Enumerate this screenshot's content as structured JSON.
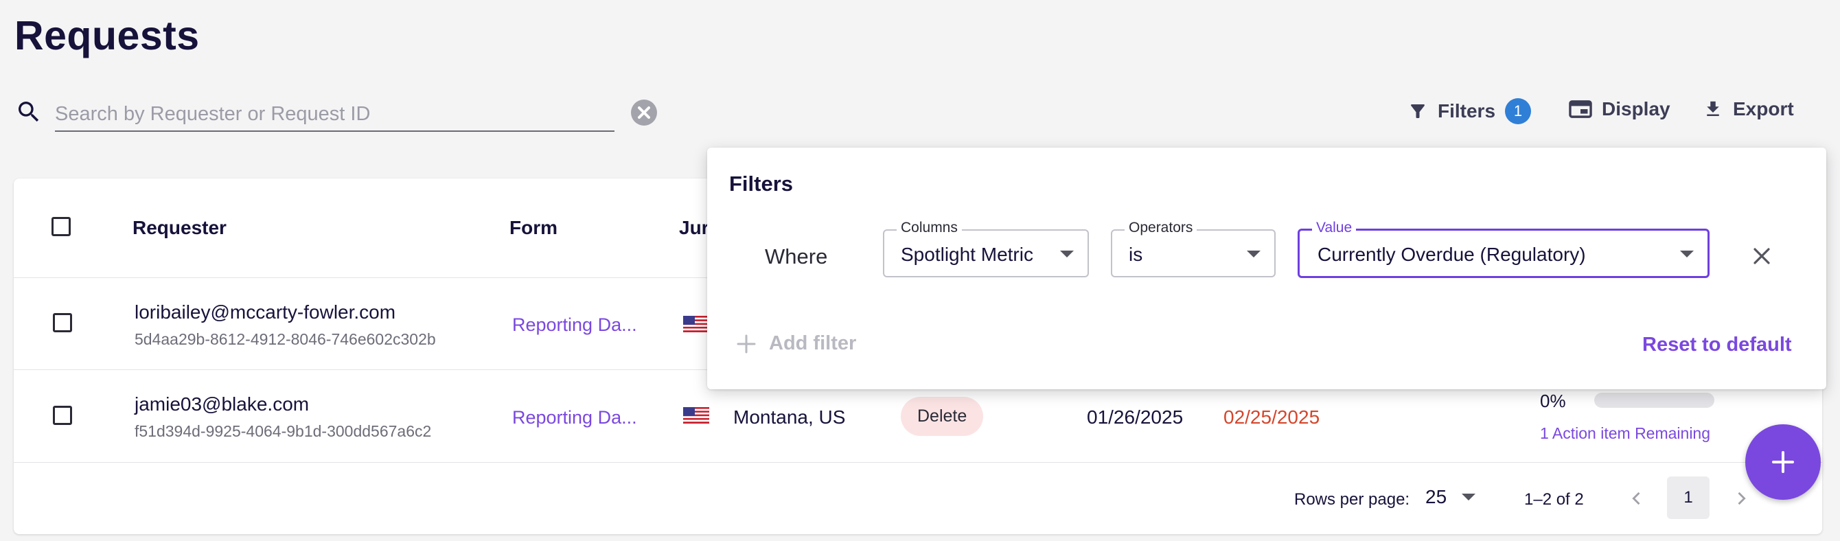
{
  "page_title": "Requests",
  "search": {
    "placeholder": "Search by Requester or Request ID",
    "value": ""
  },
  "toolbar": {
    "filters_label": "Filters",
    "filters_count": "1",
    "display_label": "Display",
    "export_label": "Export"
  },
  "table": {
    "headers": {
      "requester": "Requester",
      "form": "Form",
      "jurisdiction": "Jur"
    },
    "rows": [
      {
        "email": "loribailey@mccarty-fowler.com",
        "request_id": "5d4aa29b-8612-4912-8046-746e602c302b",
        "form": "Reporting Da...",
        "flag": "us-flag-icon"
      },
      {
        "email": "jamie03@blake.com",
        "request_id": "f51d394d-9925-4064-9b1d-300dd567a6c2",
        "form": "Reporting Da...",
        "flag": "us-flag-icon",
        "jurisdiction": "Montana, US",
        "type": "Delete",
        "submitted": "01/26/2025",
        "due": "02/25/2025",
        "progress_pct": "0%",
        "progress_value": 0,
        "actions": "1 Action item Remaining"
      }
    ]
  },
  "pagination": {
    "rows_per_page_label": "Rows per page:",
    "rows_per_page": "25",
    "range": "1–2 of 2",
    "current_page": "1"
  },
  "filters_panel": {
    "title": "Filters",
    "where_label": "Where",
    "columns": {
      "legend": "Columns",
      "value": "Spotlight Metric"
    },
    "operators": {
      "legend": "Operators",
      "value": "is"
    },
    "value": {
      "legend": "Value",
      "value": "Currently Overdue (Regulatory)"
    },
    "add_filter_label": "Add filter",
    "reset_label": "Reset to default"
  },
  "colors": {
    "accent": "#7a48df",
    "badge": "#2f7fd6",
    "due_date": "#d5462c",
    "delete_chip": "#fbe3e4"
  }
}
